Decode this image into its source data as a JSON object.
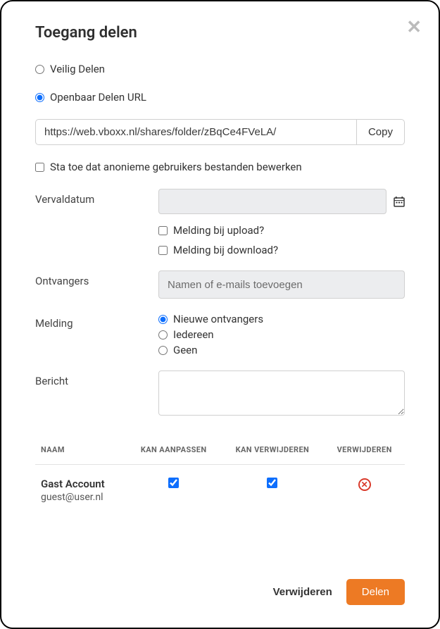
{
  "title": "Toegang delen",
  "share_mode": {
    "secure_label": "Veilig Delen",
    "public_label": "Openbaar Delen URL",
    "selected": "public"
  },
  "url": "https://web.vboxx.nl/shares/folder/zBqCe4FVeLA/",
  "copy_label": "Copy",
  "allow_anon_label": "Sta toe dat anonieme gebruikers bestanden bewerken",
  "allow_anon_checked": false,
  "expiry_label": "Vervaldatum",
  "expiry_value": "",
  "notify_upload_label": "Melding bij upload?",
  "notify_upload_checked": false,
  "notify_download_label": "Melding bij download?",
  "notify_download_checked": false,
  "recipients_label": "Ontvangers",
  "recipients_placeholder": "Namen of e-mails toevoegen",
  "notify_label": "Melding",
  "notify_options": {
    "new": "Nieuwe ontvangers",
    "all": "Iedereen",
    "none": "Geen"
  },
  "notify_selected": "new",
  "message_label": "Bericht",
  "message_value": "",
  "table": {
    "col_name": "NAAM",
    "col_edit": "KAN AANPASSEN",
    "col_delete": "KAN VERWIJDEREN",
    "col_remove": "VERWIJDEREN",
    "rows": [
      {
        "name": "Gast Account",
        "email": "guest@user.nl",
        "can_edit": true,
        "can_delete": true
      }
    ]
  },
  "footer": {
    "cancel": "Verwijderen",
    "share": "Delen"
  }
}
